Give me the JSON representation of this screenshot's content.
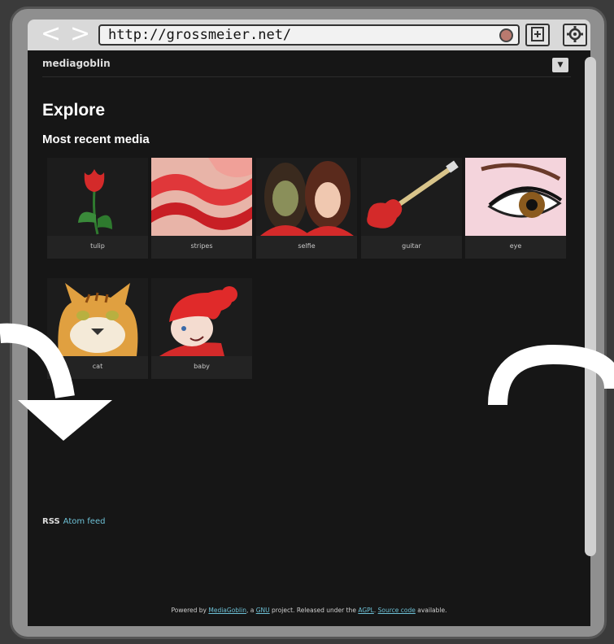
{
  "browser": {
    "back_glyph": "<",
    "forward_glyph": ">",
    "url": "http://grossmeier.net/",
    "icons": [
      "record-icon",
      "bookmark-icon",
      "settings-gear-icon"
    ]
  },
  "site": {
    "name": "mediagoblin",
    "menu_glyph": "▼"
  },
  "page": {
    "title": "Explore",
    "section_title": "Most recent media"
  },
  "media": [
    {
      "label": "tulip",
      "icon": "tulip-image"
    },
    {
      "label": "stripes",
      "icon": "stripes-image"
    },
    {
      "label": "selfie",
      "icon": "selfie-image"
    },
    {
      "label": "guitar",
      "icon": "guitar-image"
    },
    {
      "label": "eye",
      "icon": "eye-image"
    },
    {
      "label": "cat",
      "icon": "cat-image"
    },
    {
      "label": "baby",
      "icon": "baby-image"
    }
  ],
  "feed": {
    "icon_glyph": "RSS",
    "label": "Atom feed"
  },
  "footer": {
    "text1": "Powered by ",
    "link1": "MediaGoblin",
    "text2": ", a ",
    "link2": "GNU",
    "text3": " project. Released under the ",
    "link3": "AGPL",
    "text4": ". ",
    "link4": "Source code",
    "text5": " available."
  },
  "colors": {
    "background": "#161616",
    "link": "#6dc0d5",
    "accent_red": "#d42a2a"
  }
}
